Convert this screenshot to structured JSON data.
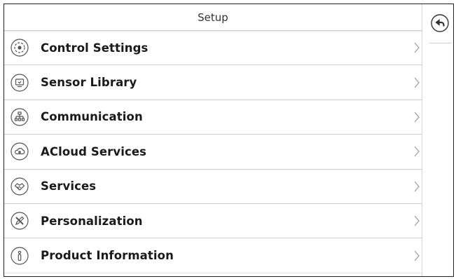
{
  "header": {
    "title": "Setup"
  },
  "menu": {
    "items": [
      {
        "label": "Control Settings",
        "icon": "control-settings-icon"
      },
      {
        "label": "Sensor Library",
        "icon": "sensor-library-icon"
      },
      {
        "label": "Communication",
        "icon": "communication-icon"
      },
      {
        "label": "ACloud Services",
        "icon": "cloud-icon"
      },
      {
        "label": "Services",
        "icon": "handshake-icon"
      },
      {
        "label": "Personalization",
        "icon": "pencil-ruler-icon"
      },
      {
        "label": "Product Information",
        "icon": "info-icon"
      }
    ]
  },
  "toolbar": {
    "back_icon": "back-arrow-icon"
  },
  "colors": {
    "border": "#222222",
    "divider": "#cdcdcd",
    "text": "#1a1a1a",
    "icon": "#555555"
  }
}
